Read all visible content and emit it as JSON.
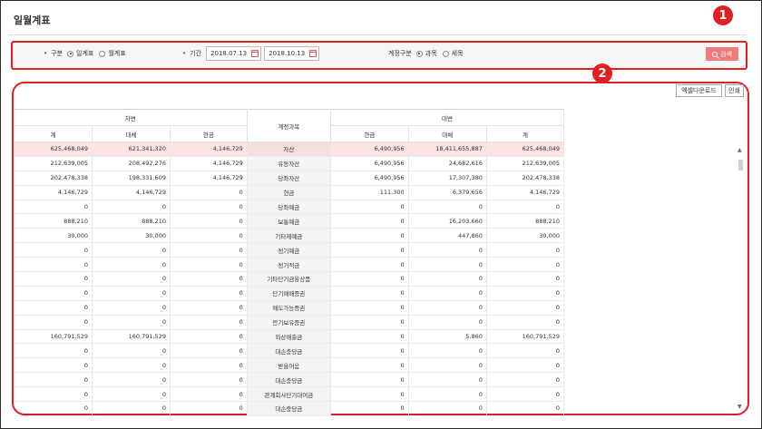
{
  "page_title": "일월계표",
  "filter": {
    "type_label": "구분",
    "type_options": [
      "일계표",
      "월계표"
    ],
    "period_label": "기간",
    "start_date": "2018.07.13",
    "end_date": "2018.10.13",
    "account_type_label": "계정구분",
    "account_type_options": [
      "과목",
      "세목"
    ],
    "search_label": "검색"
  },
  "callouts": [
    "1",
    "2"
  ],
  "toolbar": {
    "excel_label": "엑셀다운로드",
    "print_label": "인쇄"
  },
  "table": {
    "debit_group": "차변",
    "credit_group": "대변",
    "account_header": "계정과목",
    "debit_cols": [
      "계",
      "대체",
      "현금"
    ],
    "credit_cols": [
      "현금",
      "대체",
      "계"
    ],
    "rows": [
      {
        "d_total": "625,468,049",
        "d_transfer": "621,341,320",
        "d_cash": "4,146,729",
        "account": "자산",
        "c_cash": "6,490,956",
        "c_transfer": "18,411,655,887",
        "c_total": "625,468,049"
      },
      {
        "d_total": "212,639,005",
        "d_transfer": "208,492,276",
        "d_cash": "4,146,729",
        "account": "유동자산",
        "c_cash": "6,490,956",
        "c_transfer": "24,682,616",
        "c_total": "212,639,005"
      },
      {
        "d_total": "202,478,338",
        "d_transfer": "198,331,609",
        "d_cash": "4,146,729",
        "account": "당좌자산",
        "c_cash": "6,490,956",
        "c_transfer": "17,307,380",
        "c_total": "202,478,338"
      },
      {
        "d_total": "4,146,729",
        "d_transfer": "4,146,729",
        "d_cash": "0",
        "account": "현금",
        "c_cash": "111,300",
        "c_transfer": "6,379,656",
        "c_total": "4,146,729"
      },
      {
        "d_total": "0",
        "d_transfer": "0",
        "d_cash": "0",
        "account": "당좌예금",
        "c_cash": "0",
        "c_transfer": "0",
        "c_total": "0"
      },
      {
        "d_total": "888,210",
        "d_transfer": "888,210",
        "d_cash": "0",
        "account": "보통예금",
        "c_cash": "0",
        "c_transfer": "16,203,660",
        "c_total": "888,210"
      },
      {
        "d_total": "30,000",
        "d_transfer": "30,000",
        "d_cash": "0",
        "account": "기타제예금",
        "c_cash": "0",
        "c_transfer": "447,860",
        "c_total": "30,000"
      },
      {
        "d_total": "0",
        "d_transfer": "0",
        "d_cash": "0",
        "account": "정기예금",
        "c_cash": "0",
        "c_transfer": "0",
        "c_total": "0"
      },
      {
        "d_total": "0",
        "d_transfer": "0",
        "d_cash": "0",
        "account": "정기적금",
        "c_cash": "0",
        "c_transfer": "0",
        "c_total": "0"
      },
      {
        "d_total": "0",
        "d_transfer": "0",
        "d_cash": "0",
        "account": "기타단기금융상품",
        "c_cash": "0",
        "c_transfer": "0",
        "c_total": "0"
      },
      {
        "d_total": "0",
        "d_transfer": "0",
        "d_cash": "0",
        "account": "단기매매증권",
        "c_cash": "0",
        "c_transfer": "0",
        "c_total": "0"
      },
      {
        "d_total": "0",
        "d_transfer": "0",
        "d_cash": "0",
        "account": "매도가능증권",
        "c_cash": "0",
        "c_transfer": "0",
        "c_total": "0"
      },
      {
        "d_total": "0",
        "d_transfer": "0",
        "d_cash": "0",
        "account": "만기보유증권",
        "c_cash": "0",
        "c_transfer": "0",
        "c_total": "0"
      },
      {
        "d_total": "160,791,529",
        "d_transfer": "160,791,529",
        "d_cash": "0",
        "account": "외상매출금",
        "c_cash": "0",
        "c_transfer": "5,860",
        "c_total": "160,791,529"
      },
      {
        "d_total": "0",
        "d_transfer": "0",
        "d_cash": "0",
        "account": "대손충당금",
        "c_cash": "0",
        "c_transfer": "0",
        "c_total": "0"
      },
      {
        "d_total": "0",
        "d_transfer": "0",
        "d_cash": "0",
        "account": "받을어음",
        "c_cash": "0",
        "c_transfer": "0",
        "c_total": "0"
      },
      {
        "d_total": "0",
        "d_transfer": "0",
        "d_cash": "0",
        "account": "대손충당금",
        "c_cash": "0",
        "c_transfer": "0",
        "c_total": "0"
      },
      {
        "d_total": "0",
        "d_transfer": "0",
        "d_cash": "0",
        "account": "관계회사단기대여금",
        "c_cash": "0",
        "c_transfer": "0",
        "c_total": "0"
      },
      {
        "d_total": "0",
        "d_transfer": "0",
        "d_cash": "0",
        "account": "대손충당금",
        "c_cash": "0",
        "c_transfer": "0",
        "c_total": "0"
      }
    ]
  },
  "colors": {
    "accent": "#e02020",
    "search_button": "#f07b7b",
    "highlight_row": "#fbe3e3"
  }
}
